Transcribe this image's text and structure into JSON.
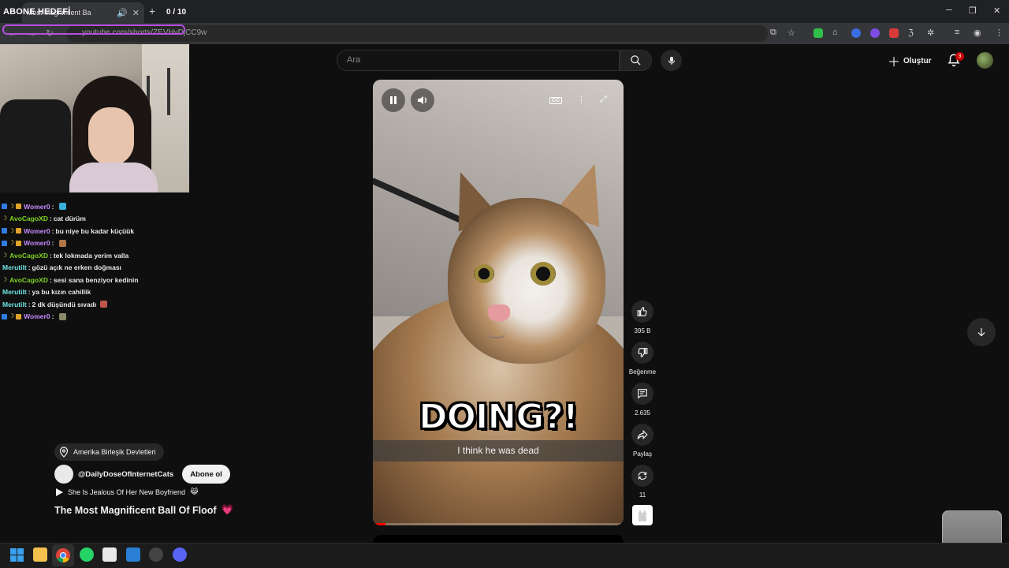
{
  "browser": {
    "tab_title": "Most Magnificent Ba",
    "url": "youtube.com/shorts/ZEVHvDjCC9w"
  },
  "stream": {
    "goal_label": "ABONE HEDEFİ",
    "goal_count": "0 / 10"
  },
  "chat": [
    {
      "user": "Womer0",
      "color": "#c78bff",
      "message": "",
      "badges": [
        "blue",
        "moon",
        "gold"
      ],
      "emote": "#3aaed8"
    },
    {
      "user": "AvoCagoXD",
      "color": "#7ed321",
      "message": "cat dürüm",
      "badges": [
        "moon"
      ]
    },
    {
      "user": "Womer0",
      "color": "#c78bff",
      "message": "bu niye bu kadar küçüük",
      "badges": [
        "blue",
        "moon",
        "gold"
      ]
    },
    {
      "user": "Womer0",
      "color": "#c78bff",
      "message": "",
      "badges": [
        "blue",
        "moon",
        "gold"
      ],
      "emote": "#b0764a"
    },
    {
      "user": "AvoCagoXD",
      "color": "#7ed321",
      "message": "tek lokmada yerim valla",
      "badges": [
        "moon"
      ]
    },
    {
      "user": "Merutilt",
      "color": "#6fe3e0",
      "message": "gözü açık ne erken doğması",
      "badges": []
    },
    {
      "user": "AvoCagoXD",
      "color": "#7ed321",
      "message": "sesi sana benziyor kedinin",
      "badges": [
        "moon"
      ]
    },
    {
      "user": "Merutilt",
      "color": "#6fe3e0",
      "message": "ya bu kızın cahillik",
      "badges": []
    },
    {
      "user": "Merutilt",
      "color": "#6fe3e0",
      "message": "2 dk düşündü sıvadı",
      "badges": [],
      "emote": "#c0554a"
    },
    {
      "user": "Womer0",
      "color": "#c78bff",
      "message": "",
      "badges": [
        "blue",
        "moon",
        "gold"
      ],
      "emote": "#8a8a6a"
    }
  ],
  "youtube": {
    "search_placeholder": "Ara",
    "create_label": "Oluştur",
    "notification_count": "3",
    "video": {
      "caption_big": "DOING?!",
      "caption_sub": "I think he was dead",
      "progress": 0.05
    },
    "actions": {
      "like_count": "395 B",
      "dislike_label": "Beğenme",
      "comment_count": "2.635",
      "share_label": "Paylaş",
      "remix_count": "11"
    },
    "meta": {
      "location": "Amerika Birleşik Devletleri",
      "channel": "@DailyDoseOfInternetCats",
      "subscribe_label": "Abone ol",
      "music": "She Is Jealous Of Her New Boyfriend",
      "music_emoji": "😹",
      "title": "The Most Magnificent Ball Of Floof",
      "title_emoji": "💗"
    }
  },
  "colors": {
    "accent": "#ff0000",
    "background": "#0f0f0f"
  }
}
